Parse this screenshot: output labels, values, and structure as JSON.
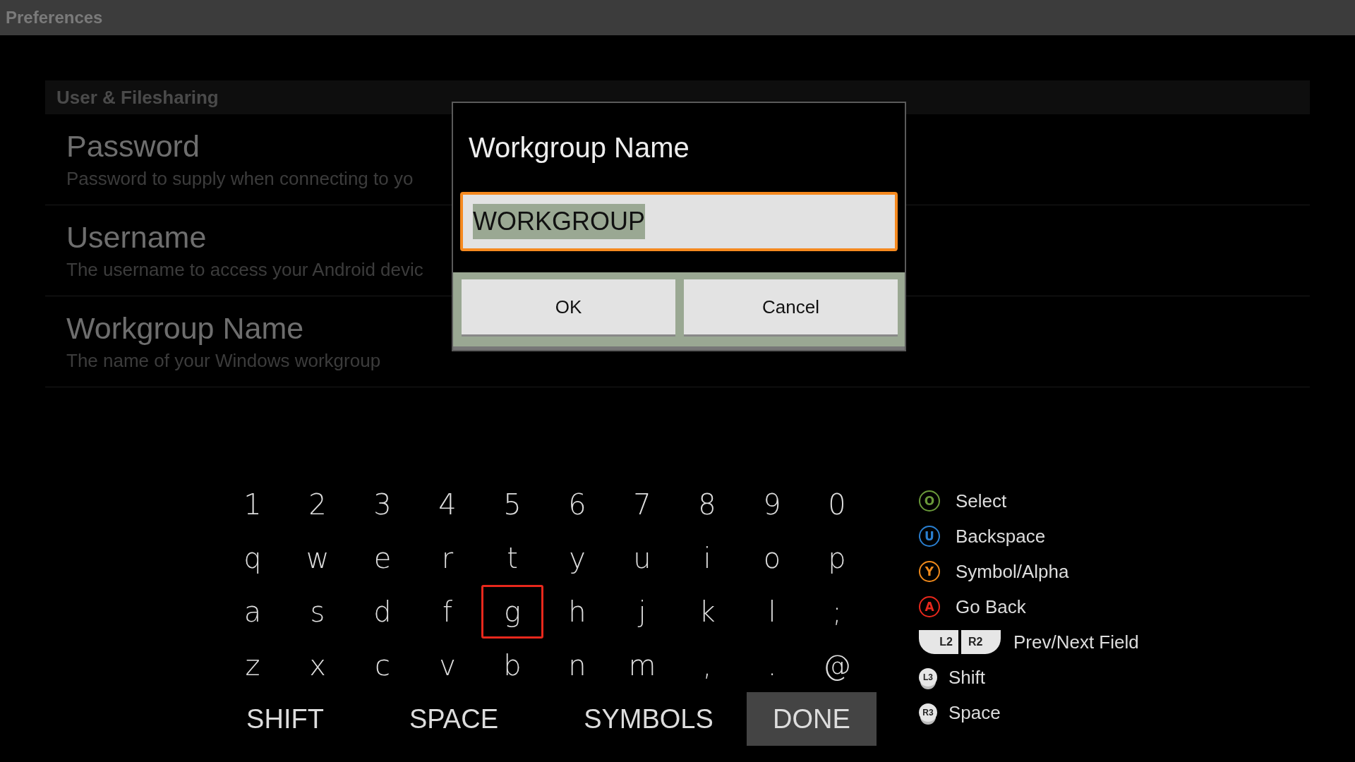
{
  "title_bar": {
    "title": "Preferences"
  },
  "section": {
    "header": "User & Filesharing"
  },
  "preferences": [
    {
      "title": "Password",
      "summary": "Password to supply when connecting to yo"
    },
    {
      "title": "Username",
      "summary": "The username to access your Android devic"
    },
    {
      "title": "Workgroup Name",
      "summary": "The name of your Windows workgroup"
    }
  ],
  "dialog": {
    "title": "Workgroup Name",
    "field": {
      "value": "WORKGROUP",
      "focused": true,
      "text_selected": true
    },
    "buttons": [
      {
        "label": "OK"
      },
      {
        "label": "Cancel"
      }
    ]
  },
  "keyboard": {
    "rows": [
      [
        {
          "label": "1",
          "focused": false
        },
        {
          "label": "2",
          "focused": false
        },
        {
          "label": "3",
          "focused": false
        },
        {
          "label": "4",
          "focused": false
        },
        {
          "label": "5",
          "focused": false
        },
        {
          "label": "6",
          "focused": false
        },
        {
          "label": "7",
          "focused": false
        },
        {
          "label": "8",
          "focused": false
        },
        {
          "label": "9",
          "focused": false
        },
        {
          "label": "0",
          "focused": false
        }
      ],
      [
        {
          "label": "q",
          "focused": false
        },
        {
          "label": "w",
          "focused": false
        },
        {
          "label": "e",
          "focused": false
        },
        {
          "label": "r",
          "focused": false
        },
        {
          "label": "t",
          "focused": false
        },
        {
          "label": "y",
          "focused": false
        },
        {
          "label": "u",
          "focused": false
        },
        {
          "label": "i",
          "focused": false
        },
        {
          "label": "o",
          "focused": false
        },
        {
          "label": "p",
          "focused": false
        }
      ],
      [
        {
          "label": "a",
          "focused": false
        },
        {
          "label": "s",
          "focused": false
        },
        {
          "label": "d",
          "focused": false
        },
        {
          "label": "f",
          "focused": false
        },
        {
          "label": "g",
          "focused": true
        },
        {
          "label": "h",
          "focused": false
        },
        {
          "label": "j",
          "focused": false
        },
        {
          "label": "k",
          "focused": false
        },
        {
          "label": "l",
          "focused": false
        },
        {
          "label": ";",
          "focused": false
        }
      ],
      [
        {
          "label": "z",
          "focused": false
        },
        {
          "label": "x",
          "focused": false
        },
        {
          "label": "c",
          "focused": false
        },
        {
          "label": "v",
          "focused": false
        },
        {
          "label": "b",
          "focused": false
        },
        {
          "label": "n",
          "focused": false
        },
        {
          "label": "m",
          "focused": false
        },
        {
          "label": ",",
          "focused": false
        },
        {
          "label": ".",
          "focused": false
        },
        {
          "label": "@",
          "focused": false
        }
      ]
    ],
    "actions": [
      {
        "label": "SHIFT",
        "highlighted": false
      },
      {
        "label": "SPACE",
        "highlighted": false
      },
      {
        "label": "SYMBOLS",
        "highlighted": false
      },
      {
        "label": "DONE",
        "highlighted": true
      }
    ]
  },
  "legend": [
    {
      "kind": "face_button",
      "symbol": "O",
      "color": "#6a9a3a",
      "label": "Select"
    },
    {
      "kind": "face_button",
      "symbol": "U",
      "color": "#2a7fd0",
      "label": "Backspace"
    },
    {
      "kind": "face_button",
      "symbol": "Y",
      "color": "#f08a1c",
      "label": "Symbol/Alpha"
    },
    {
      "kind": "face_button",
      "symbol": "A",
      "color": "#e8281c",
      "label": "Go Back"
    },
    {
      "kind": "triggers",
      "keys": [
        "L2",
        "R2"
      ],
      "label": "Prev/Next Field"
    },
    {
      "kind": "stick",
      "keys": [
        "L3"
      ],
      "label": "Shift"
    },
    {
      "kind": "stick",
      "keys": [
        "R3"
      ],
      "label": "Space"
    }
  ]
}
